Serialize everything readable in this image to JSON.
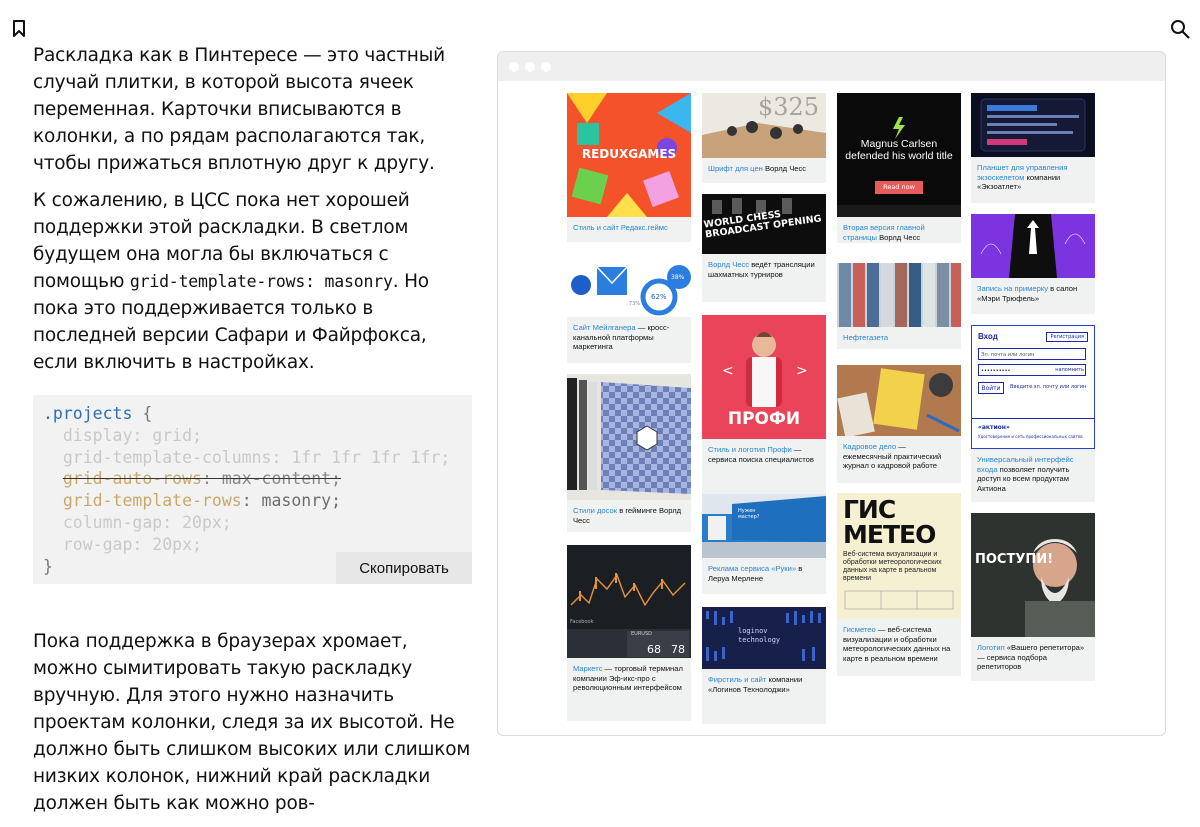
{
  "article": {
    "para1": "Раскладка как в Пинтересе — это частный случай плитки, в которой высота ячеек переменная. Карточки вписываются в колонки, а по рядам располагаются так, чтобы прижаться вплотную друг к другу.",
    "para2_before": "К сожалению, в ЦСС пока нет хорошей поддержки этой раскладки. В светлом будущем она могла бы включаться с помощью ",
    "para2_code": "grid-template-rows: masonry",
    "para2_after": ". Но пока это поддерживается только в последней версии Сафари и Файрфокса, если включить в настройках.",
    "para3": "Пока поддержка в браузерах хромает, можно сымитировать такую раскладку вручную. Для этого нужно назначить проектам колонки, следя за их высотой. Не должно быть слишком высоких или слишком низких колонок, нижний край раскладки должен быть как можно ров-"
  },
  "code": {
    "selector": ".projects",
    "open": " {",
    "line1": "  display: grid;",
    "line2": "  grid-template-columns: 1fr 1fr 1fr 1fr;",
    "line3_prop": "grid-auto-rows",
    "line3_val": ": max-content;",
    "line4_prop": "grid-template-rows",
    "line4_val": ": masonry;",
    "line5": "  column-gap: 20px;",
    "line6": "  row-gap: 20px;",
    "close": "}",
    "copy_label": "Скопировать"
  },
  "cards": {
    "c1": {
      "img_text": "REDUXGAMES",
      "link": "Стиль и сайт Редакс.геймс",
      "rest": ""
    },
    "c2": {
      "img_text": "62%",
      "img_text2": "38%",
      "img_text3": "73%",
      "link": "Сайт Мейлганера",
      "rest": " — кросс-канальной платформы маркетинга"
    },
    "c3": {
      "link": "Стили досок",
      "rest": " в гейминге Ворлд Чесс"
    },
    "c4": {
      "img_text": "Facebook",
      "img_text2": "EURUSD",
      "img_text3": "68",
      "img_text4": "78",
      "link": "Маркетс",
      "rest": " — торговый терминал компании Эф-икс-про с революционным интерфейсом"
    },
    "c5": {
      "img_text": "$325",
      "link": "Шрифт для цен",
      "rest": " Ворлд Чесс"
    },
    "c6": {
      "img_text": "WORLD CHESS BROADCAST OPENING",
      "link": "Ворлд Чесс",
      "rest": " ведёт трансляции шахматных турниров"
    },
    "c7": {
      "img_text": "ПРОФИ",
      "link": "Стиль и логотип Профи",
      "rest": " — сервиса поиска специалистов"
    },
    "c8": {
      "img_text": "Нужен мастер?",
      "link": "Реклама сервиса «Руки»",
      "rest": " в Леруа Мерлене"
    },
    "c9": {
      "img_text": "loginov technology",
      "link": "Фирстиль и сайт",
      "rest": " компании «Логинов Технолоджи»"
    },
    "c10": {
      "img_text": "Magnus Carlsen defended his world title",
      "img_button": "Read now",
      "link": "Вторая версия главной страницы",
      "rest": " Ворлд Чесс"
    },
    "c11": {
      "link": "Нефтегазета",
      "rest": ""
    },
    "c12": {
      "link": "Кадровое дело",
      "rest": " — ежемесячный практический журнал о кадровой работе"
    },
    "c13": {
      "img_text": "ГИС МЕТЕО",
      "img_sub": "Веб-система визуализации и обработки метеорологических данных на карте в реальном времени",
      "link": "Гисметео",
      "rest": " — веб-система визуализации и обработки метеорологических данных на карте в реальном времени"
    },
    "c14": {
      "link": "Планшет для управления экзоскелетом",
      "rest": " компании «Экзоатлет»"
    },
    "c15": {
      "link": "Запись на примерку",
      "rest": " в салон «Мэри Трюфель»"
    },
    "c16": {
      "form_title": "Вход",
      "form_reg": "Регистрация",
      "form_login_ph": "Эл. почта или логин",
      "form_pass": "••••••••••",
      "form_remind": "напомнить",
      "form_btn": "Войти",
      "form_hint": "Введите эл. почту или логин",
      "form_brand": "«актион»",
      "form_brand_sub": "Удостоверение и сеть профессиональных сайтов",
      "link": "Универсальный интерфейс входа",
      "rest": " позволяет получить доступ ко всем продуктам Актиона"
    },
    "c17": {
      "img_text": "ПОСТУПИ!",
      "link": "Логотип",
      "rest": " «Вашего репетитора» — сервиса подбора репетиторов"
    }
  }
}
